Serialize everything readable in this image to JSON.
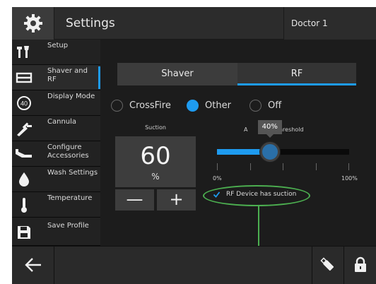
{
  "header": {
    "title": "Settings",
    "user": "Doctor 1"
  },
  "sidebar": {
    "items": [
      {
        "label": "Setup",
        "icon": "tools-icon",
        "active": false
      },
      {
        "label": "Shaver and RF",
        "icon": "shaver-icon",
        "active": true
      },
      {
        "label": "Display Mode",
        "icon": "display-mode-icon",
        "icon_text": "40",
        "active": false
      },
      {
        "label": "Cannula",
        "icon": "cannula-icon",
        "active": false
      },
      {
        "label": "Configure Accessories",
        "icon": "accessories-icon",
        "active": false
      },
      {
        "label": "Wash Settings",
        "icon": "droplet-icon",
        "active": false
      },
      {
        "label": "Temperature",
        "icon": "thermometer-icon",
        "active": false
      },
      {
        "label": "Save Profile",
        "icon": "save-icon",
        "active": false
      }
    ]
  },
  "tabs": [
    {
      "label": "Shaver",
      "selected": false
    },
    {
      "label": "RF",
      "selected": true
    }
  ],
  "mode": {
    "options": [
      "CrossFire",
      "Other",
      "Off"
    ],
    "selected": "Other"
  },
  "suction": {
    "title": "Suction",
    "value": "60",
    "unit": "%",
    "minus_label": "—",
    "plus_label": "+"
  },
  "threshold": {
    "title_left": "A",
    "title_right": "n Threshold",
    "value_percent": 40,
    "tooltip": "40%",
    "min_label": "0%",
    "max_label": "100%"
  },
  "rf_suction_checkbox": {
    "label": "RF Device has suction",
    "checked": true
  },
  "colors": {
    "accent": "#1e9bf0",
    "highlight": "#4caf50"
  }
}
